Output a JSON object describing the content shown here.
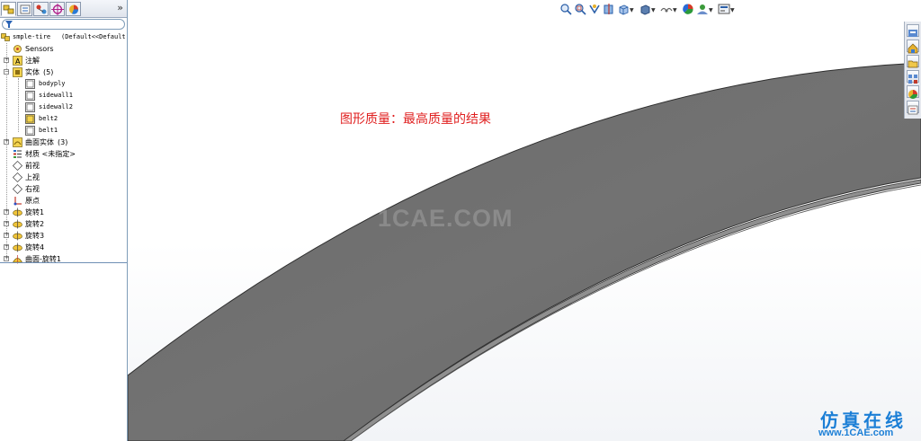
{
  "feature_tree": {
    "root": {
      "label": "smple-tire",
      "config": "(Default<<Default"
    },
    "items": [
      {
        "label": "Sensors",
        "icon": "sensors-icon",
        "expandable": false
      },
      {
        "label": "注解",
        "icon": "annotations-icon",
        "expandable": true
      },
      {
        "label": "实体",
        "count": "(5)",
        "icon": "solid-bodies-icon",
        "expandable": true
      },
      {
        "label": "bodyply",
        "icon": "solid-body-icon"
      },
      {
        "label": "sidewall1",
        "icon": "solid-body-icon"
      },
      {
        "label": "sidewall2",
        "icon": "solid-body-icon"
      },
      {
        "label": "belt2",
        "icon": "solid-body-selected-icon"
      },
      {
        "label": "belt1",
        "icon": "solid-body-icon"
      },
      {
        "label": "曲面实体",
        "count": "(3)",
        "icon": "surface-bodies-icon",
        "expandable": true
      },
      {
        "label": "材质 <未指定>",
        "icon": "material-icon",
        "expandable": false
      },
      {
        "label": "前视",
        "icon": "plane-icon"
      },
      {
        "label": "上视",
        "icon": "plane-icon"
      },
      {
        "label": "右视",
        "icon": "plane-icon"
      },
      {
        "label": "原点",
        "icon": "origin-icon"
      },
      {
        "label": "旋转1",
        "icon": "revolve-icon",
        "expandable": true
      },
      {
        "label": "旋转2",
        "icon": "revolve-icon",
        "expandable": true
      },
      {
        "label": "旋转3",
        "icon": "revolve-icon",
        "expandable": true
      },
      {
        "label": "旋转4",
        "icon": "revolve-icon",
        "expandable": true
      },
      {
        "label": "曲面-旋转1",
        "icon": "surface-revolve-icon",
        "expandable": true
      }
    ]
  },
  "panel": {
    "collapse_label": "»"
  },
  "viewport": {
    "annotation": "图形质量：最高质量的结果",
    "watermark": "1CAE.COM",
    "brand_cn": "仿真在线",
    "brand_url": "www.1CAE.com"
  },
  "colors": {
    "body": "#6e6e6e",
    "annotation": "#e02020",
    "brand": "#1c7fd6"
  },
  "toolbar_icons": [
    "zoom-to-fit-icon",
    "zoom-area-icon",
    "previous-view-icon",
    "section-view-icon",
    "view-orientation-icon",
    "display-style-icon",
    "hide-show-icon",
    "edit-appearance-icon",
    "apply-scene-icon",
    "view-settings-icon"
  ],
  "task_pane_icons": [
    "resources-icon",
    "design-library-icon",
    "file-explorer-icon",
    "view-palette-icon",
    "appearances-icon",
    "custom-properties-icon"
  ]
}
